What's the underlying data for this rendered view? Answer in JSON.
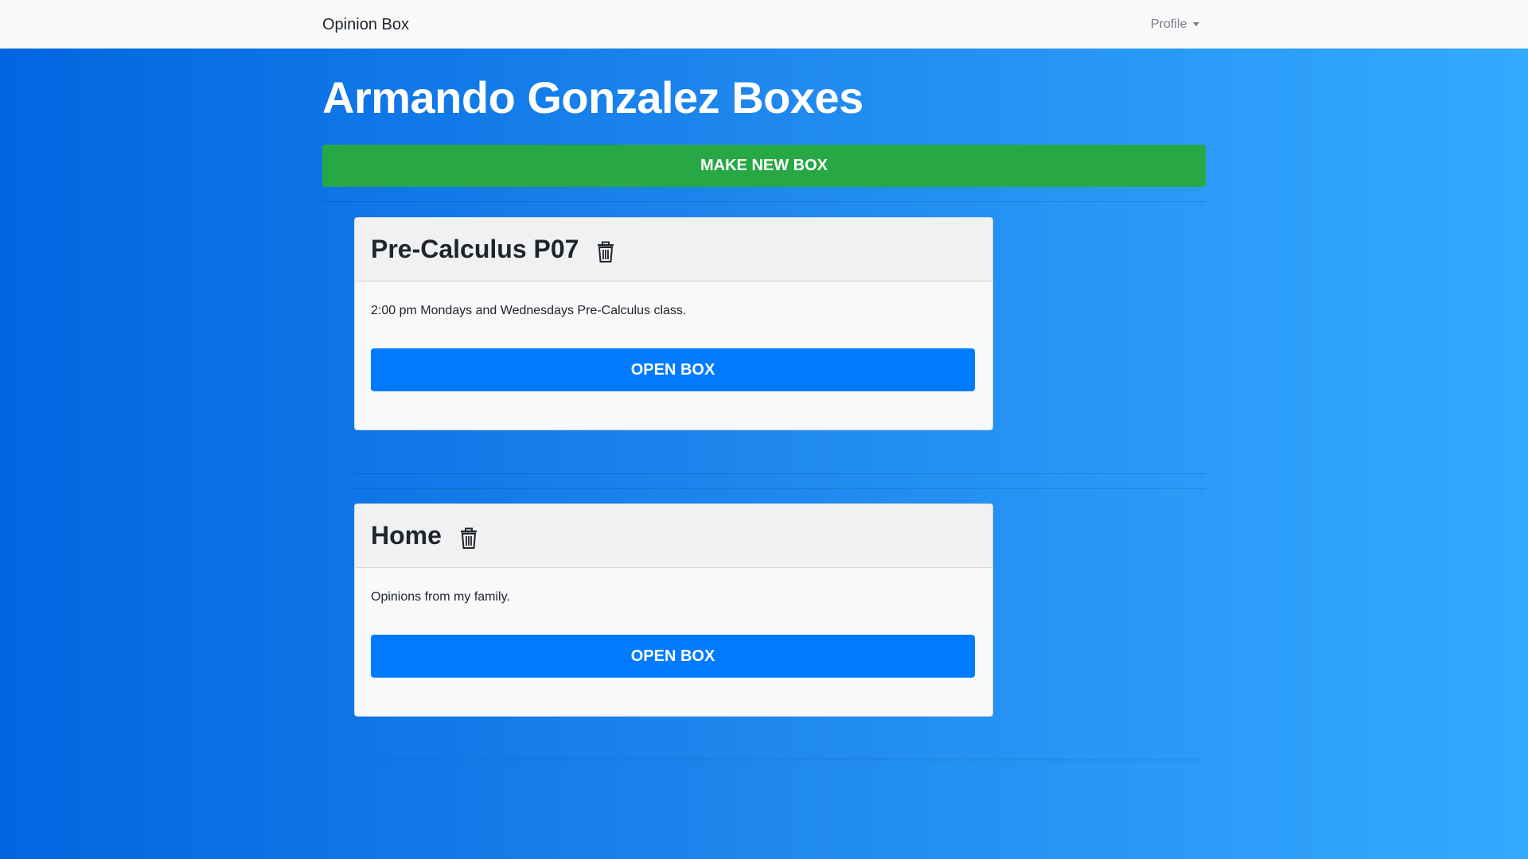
{
  "navbar": {
    "brand": "Opinion Box",
    "profile_label": "Profile"
  },
  "page": {
    "title": "Armando Gonzalez Boxes",
    "make_new_box_label": "MAKE NEW BOX"
  },
  "boxes": [
    {
      "title": "Pre-Calculus P07",
      "description": "2:00 pm Mondays and Wednesdays Pre-Calculus class.",
      "open_label": "OPEN BOX",
      "delete_icon": "trash-icon"
    },
    {
      "title": "Home",
      "description": "Opinions from my family.",
      "open_label": "OPEN BOX",
      "delete_icon": "trash-icon"
    }
  ],
  "colors": {
    "navbar_bg": "#f8f9fa",
    "gradient_start": "#0166e0",
    "gradient_end": "#34aaff",
    "success": "#28a745",
    "primary": "#007bff"
  }
}
